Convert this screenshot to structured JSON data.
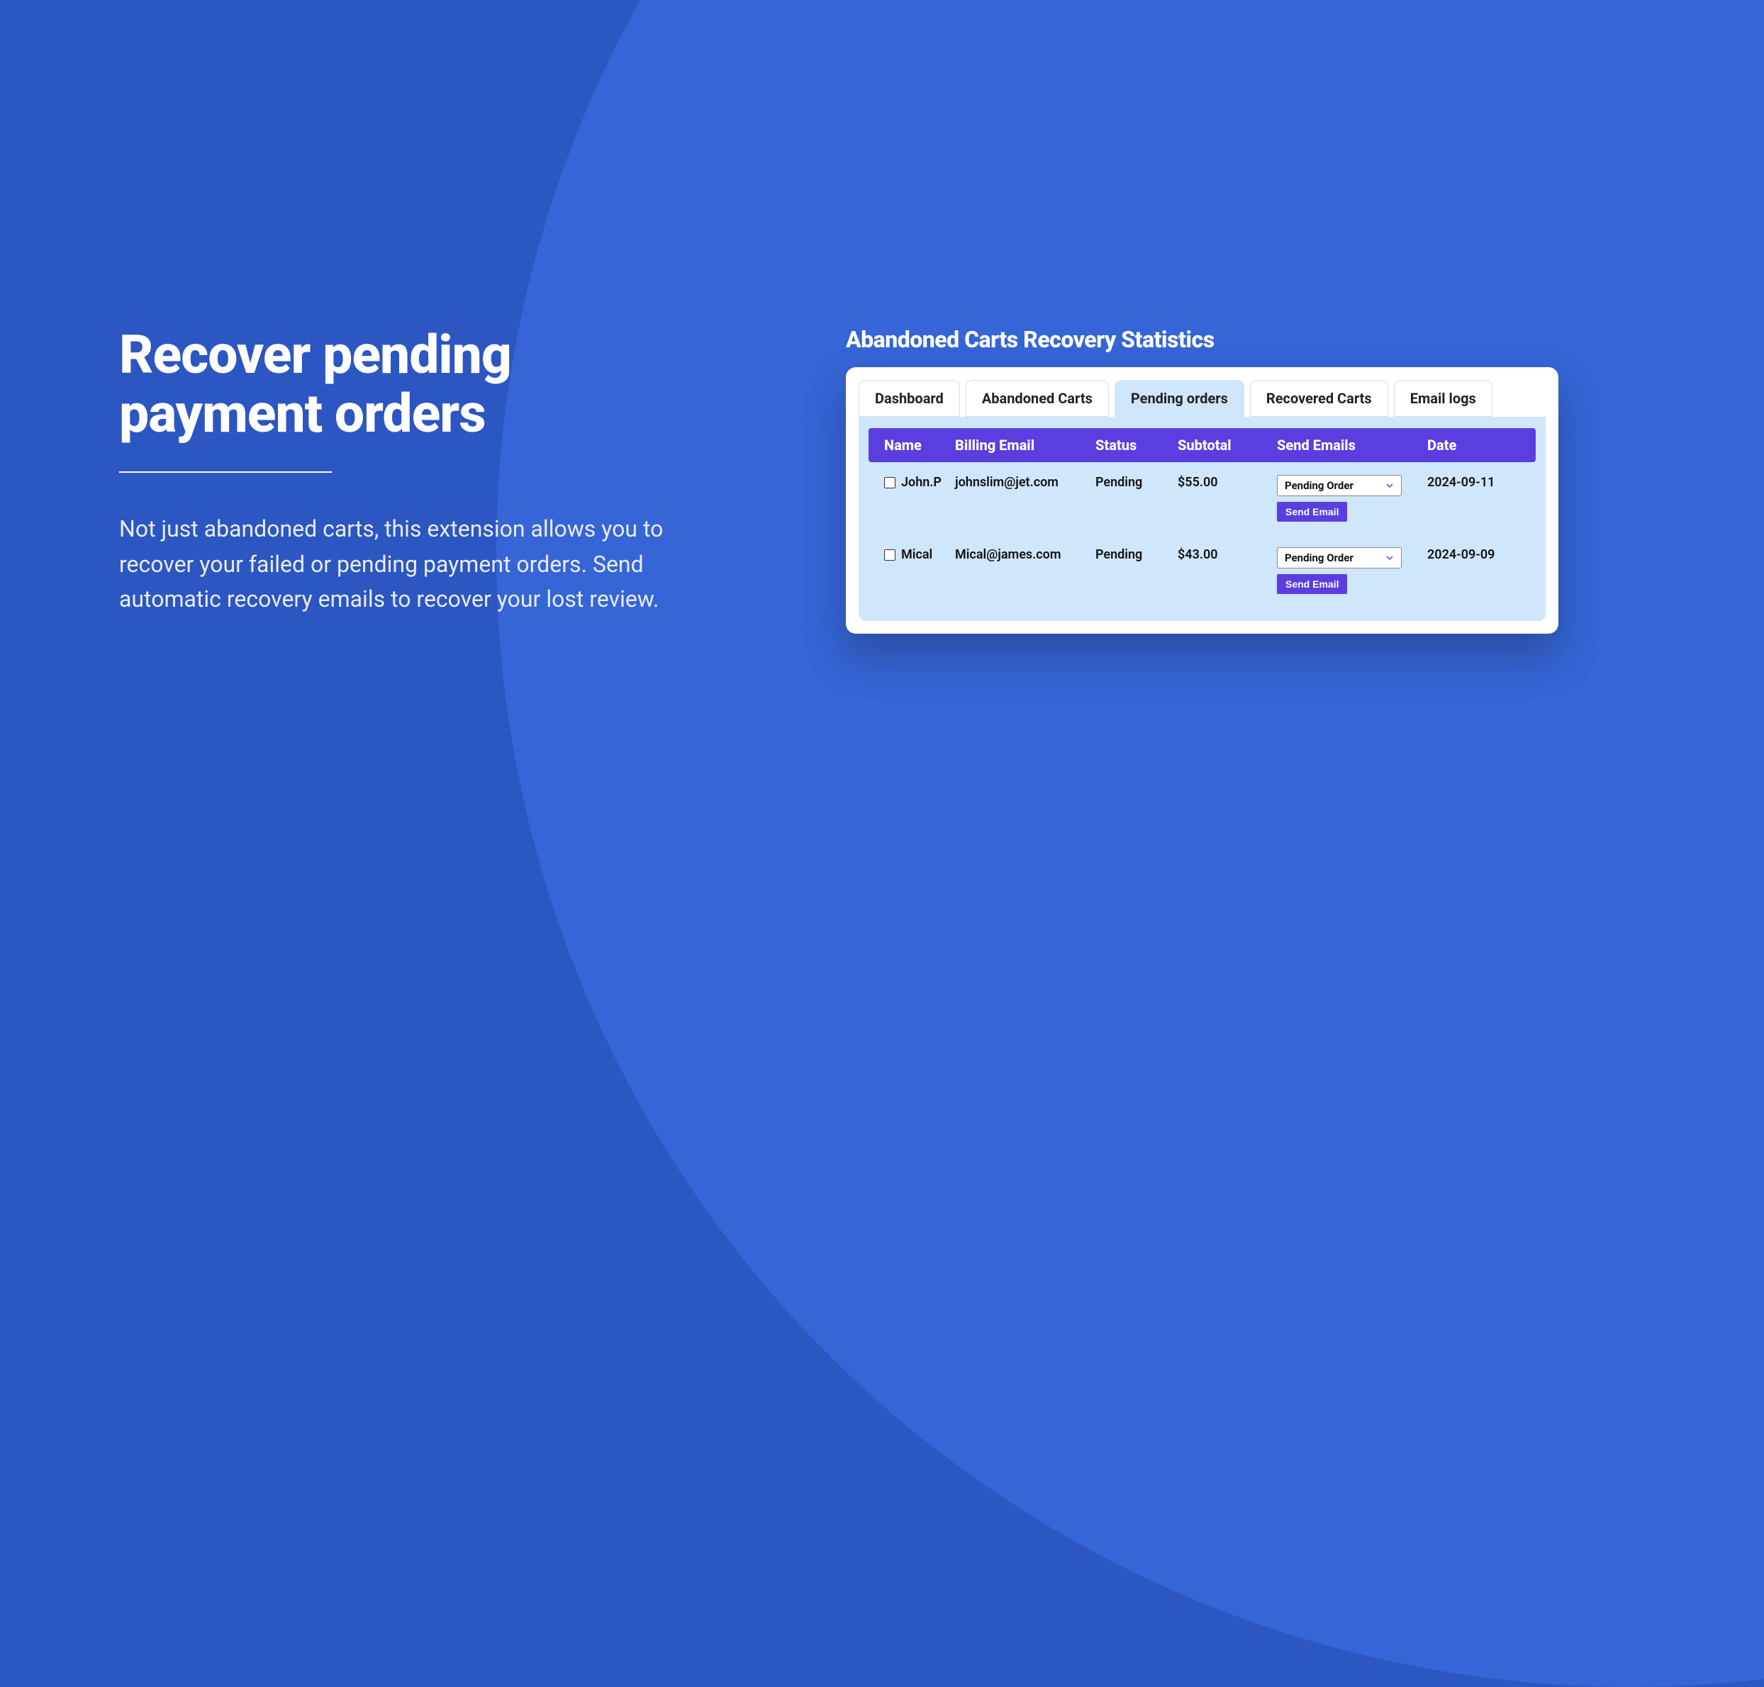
{
  "left": {
    "heading_line1": "Recover pending",
    "heading_line2": "payment orders",
    "description": "Not just abandoned carts, this extension allows you to recover your failed or pending payment orders. Send automatic recovery emails to recover your lost review."
  },
  "card": {
    "title": "Abandoned Carts Recovery Statistics",
    "tabs": [
      {
        "label": "Dashboard",
        "active": false
      },
      {
        "label": "Abandoned Carts",
        "active": false
      },
      {
        "label": "Pending orders",
        "active": true
      },
      {
        "label": "Recovered Carts",
        "active": false
      },
      {
        "label": "Email logs",
        "active": false
      }
    ],
    "columns": {
      "name": "Name",
      "email": "Billing Email",
      "status": "Status",
      "subtotal": "Subtotal",
      "send": "Send Emails",
      "date": "Date"
    },
    "rows": [
      {
        "name": "John.P",
        "email": "johnslim@jet.com",
        "status": "Pending",
        "subtotal": "$55.00",
        "dropdown": "Pending Order",
        "button": "Send Email",
        "date": "2024-09-11"
      },
      {
        "name": "Mical",
        "email": "Mical@james.com",
        "status": "Pending",
        "subtotal": "$43.00",
        "dropdown": "Pending Order",
        "button": "Send Email",
        "date": "2024-09-09"
      }
    ]
  }
}
